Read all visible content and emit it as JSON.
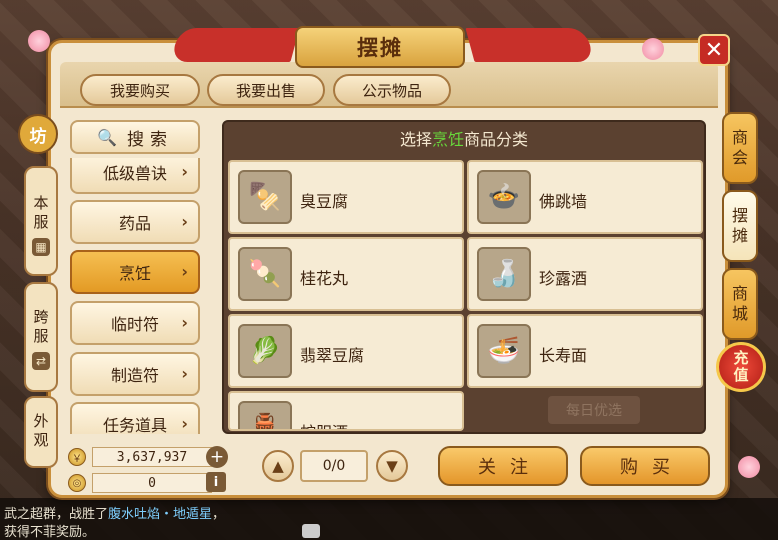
{
  "window": {
    "title": "摆摊",
    "close": "✕"
  },
  "top_tabs": [
    {
      "label": "我要购买"
    },
    {
      "label": "我要出售"
    },
    {
      "label": "公示物品"
    }
  ],
  "left_tabs": {
    "logo": "坊",
    "local": "本服",
    "cross": "跨服",
    "outer": "外观"
  },
  "right_tabs": [
    {
      "label": "商会"
    },
    {
      "label": "摆摊"
    },
    {
      "label": "商城"
    }
  ],
  "recharge": "充值",
  "search": {
    "label": "搜索"
  },
  "categories": [
    {
      "label": "低级兽诀"
    },
    {
      "label": "药品"
    },
    {
      "label": "烹饪"
    },
    {
      "label": "临时符"
    },
    {
      "label": "制造符"
    },
    {
      "label": "任务道具"
    }
  ],
  "goods_header": {
    "pre": "选择",
    "highlight": "烹饪",
    "post": "商品分类"
  },
  "items": [
    {
      "name": "臭豆腐",
      "icon": "🍢"
    },
    {
      "name": "佛跳墙",
      "icon": "🍲"
    },
    {
      "name": "桂花丸",
      "icon": "🍡"
    },
    {
      "name": "珍露酒",
      "icon": "🍶"
    },
    {
      "name": "翡翠豆腐",
      "icon": "🥬"
    },
    {
      "name": "长寿面",
      "icon": "🍜"
    },
    {
      "name": "蛇胆酒",
      "icon": "🏺"
    }
  ],
  "ghost_button": "每日优选",
  "money": {
    "gold": "3,637,937",
    "silver": "0"
  },
  "pager": {
    "indicator": "0/0"
  },
  "actions": {
    "follow": "关注",
    "buy": "购买"
  },
  "chat": {
    "line1_pre": "武之超群，战胜了",
    "line1_hl": "腹水吐焰・地遁星",
    "line1_post": "，",
    "line2": "获得不菲奖励。"
  }
}
